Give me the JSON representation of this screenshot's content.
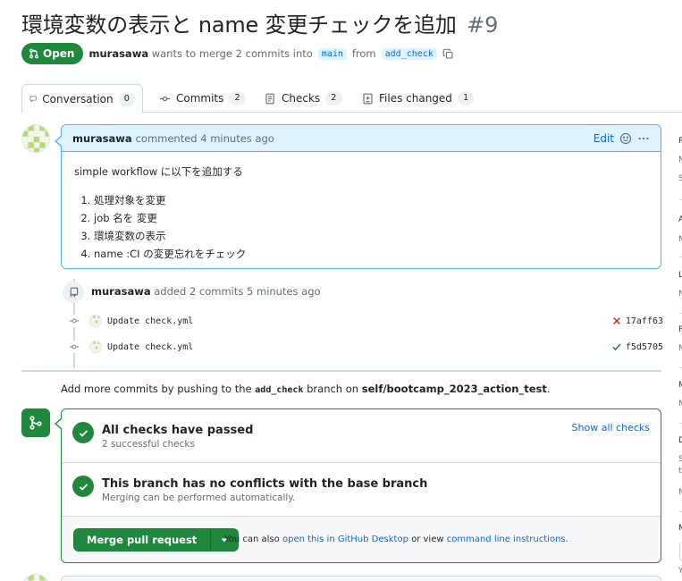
{
  "pr": {
    "title": "環境変数の表示と name 変更チェックを追加",
    "number": "#9",
    "state": "Open",
    "author": "murasawa",
    "merge_text": "wants to merge 2 commits into",
    "base_branch": "main",
    "from_text": "from",
    "head_branch": "add_check"
  },
  "tabs": [
    {
      "label": "Conversation",
      "count": "0"
    },
    {
      "label": "Commits",
      "count": "2"
    },
    {
      "label": "Checks",
      "count": "2"
    },
    {
      "label": "Files changed",
      "count": "1"
    }
  ],
  "comment": {
    "author": "murasawa",
    "action": "commented 4 minutes ago",
    "edit_label": "Edit",
    "intro": "simple workflow に以下を追加する",
    "items": [
      "処理対象を変更",
      "job 名を 変更",
      "環境変数の表示",
      "name :CI の変更忘れをチェック"
    ]
  },
  "commits_event": {
    "author": "murasawa",
    "action": "added 2 commits 5 minutes ago",
    "commits": [
      {
        "message": "Update check.yml",
        "status": "failure",
        "sha": "17aff63"
      },
      {
        "message": "Update check.yml",
        "status": "success",
        "sha": "f5d5705"
      }
    ]
  },
  "push_hint": {
    "prefix": "Add more commits by pushing to the",
    "branch": "add_check",
    "middle": "branch on",
    "repo": "self/bootcamp_2023_action_test",
    "suffix": "."
  },
  "merge": {
    "checks_title": "All checks have passed",
    "checks_sub": "2 successful checks",
    "show_all": "Show all checks",
    "conflict_title": "This branch has no conflicts with the base branch",
    "conflict_sub": "Merging can be performed automatically.",
    "button": "Merge pull request",
    "hint_prefix": "You can also",
    "hint_link1": "open this in GitHub Desktop",
    "hint_middle": "or view",
    "hint_link2": "command line instructions",
    "hint_suffix": "."
  },
  "sidebar_fragments": [
    "R",
    "N",
    "S",
    "A",
    "N",
    "L",
    "N",
    "P",
    "N",
    "M",
    "N",
    "D",
    "S",
    "t",
    "N",
    "N",
    "Y"
  ],
  "colors": {
    "accent_green": "#1f883d",
    "link_blue": "#0969da",
    "comment_header": "#ddf4ff",
    "failure_red": "#cf222e"
  }
}
